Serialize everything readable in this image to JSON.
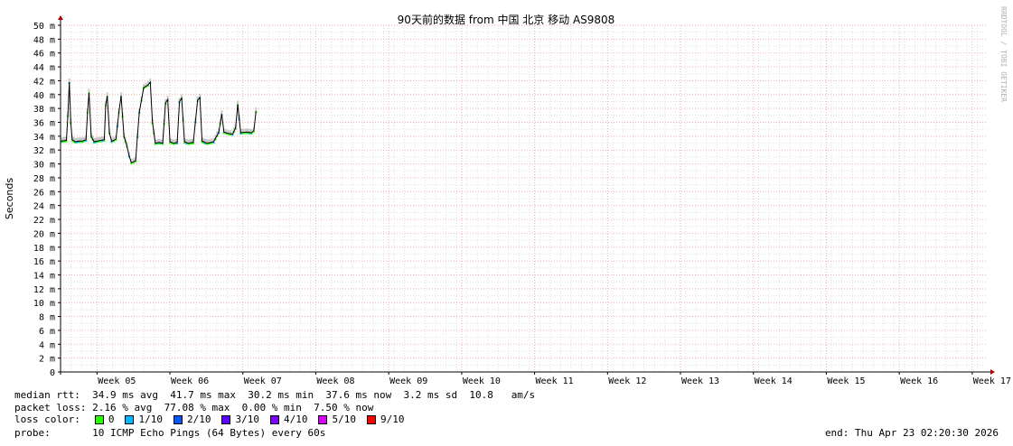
{
  "chart_data": {
    "type": "line",
    "title": "90天前的数据 from 中国 北京 移动 AS9808",
    "ylabel": "Seconds",
    "watermark": "RRDTOOL / TOBI OETIKER",
    "ylim": [
      0,
      50
    ],
    "y_unit": "ms",
    "yticks": [
      {
        "v": 0,
        "label": "0"
      },
      {
        "v": 2,
        "label": "2 m"
      },
      {
        "v": 4,
        "label": "4 m"
      },
      {
        "v": 6,
        "label": "6 m"
      },
      {
        "v": 8,
        "label": "8 m"
      },
      {
        "v": 10,
        "label": "10 m"
      },
      {
        "v": 12,
        "label": "12 m"
      },
      {
        "v": 14,
        "label": "14 m"
      },
      {
        "v": 16,
        "label": "16 m"
      },
      {
        "v": 18,
        "label": "18 m"
      },
      {
        "v": 20,
        "label": "20 m"
      },
      {
        "v": 22,
        "label": "22 m"
      },
      {
        "v": 24,
        "label": "24 m"
      },
      {
        "v": 26,
        "label": "26 m"
      },
      {
        "v": 28,
        "label": "28 m"
      },
      {
        "v": 30,
        "label": "30 m"
      },
      {
        "v": 32,
        "label": "32 m"
      },
      {
        "v": 34,
        "label": "34 m"
      },
      {
        "v": 36,
        "label": "36 m"
      },
      {
        "v": 38,
        "label": "38 m"
      },
      {
        "v": 40,
        "label": "40 m"
      },
      {
        "v": 42,
        "label": "42 m"
      },
      {
        "v": 44,
        "label": "44 m"
      },
      {
        "v": 46,
        "label": "46 m"
      },
      {
        "v": 48,
        "label": "48 m"
      },
      {
        "v": 50,
        "label": "50 m"
      }
    ],
    "xlim": [
      4.5,
      17.2
    ],
    "xticks": [
      {
        "v": 5,
        "label": "Week 05"
      },
      {
        "v": 6,
        "label": "Week 06"
      },
      {
        "v": 7,
        "label": "Week 07"
      },
      {
        "v": 8,
        "label": "Week 08"
      },
      {
        "v": 9,
        "label": "Week 09"
      },
      {
        "v": 10,
        "label": "Week 10"
      },
      {
        "v": 11,
        "label": "Week 11"
      },
      {
        "v": 12,
        "label": "Week 12"
      },
      {
        "v": 13,
        "label": "Week 13"
      },
      {
        "v": 14,
        "label": "Week 14"
      },
      {
        "v": 15,
        "label": "Week 15"
      },
      {
        "v": 16,
        "label": "Week 16"
      },
      {
        "v": 17,
        "label": "Week 17"
      }
    ],
    "grid": true,
    "series": [
      {
        "name": "median rtt",
        "x": [
          4.51,
          4.58,
          4.6,
          4.62,
          4.64,
          4.66,
          4.7,
          4.75,
          4.8,
          4.85,
          4.87,
          4.89,
          4.92,
          4.96,
          5.0,
          5.05,
          5.1,
          5.12,
          5.14,
          5.17,
          5.2,
          5.23,
          5.26,
          5.3,
          5.33,
          5.37,
          5.41,
          5.44,
          5.47,
          5.5,
          5.53,
          5.58,
          5.64,
          5.7,
          5.73,
          5.76,
          5.8,
          5.85,
          5.9,
          5.94,
          5.97,
          6.0,
          6.05,
          6.1,
          6.13,
          6.16,
          6.2,
          6.25,
          6.32,
          6.38,
          6.41,
          6.44,
          6.48,
          6.52,
          6.6,
          6.67,
          6.71,
          6.74,
          6.8,
          6.86,
          6.9,
          6.93,
          6.97,
          7.05,
          7.12,
          7.15,
          7.18
        ],
        "values": [
          33.3,
          33.4,
          37.0,
          41.8,
          36.0,
          33.5,
          33.2,
          33.3,
          33.3,
          33.5,
          37.5,
          40.3,
          34.0,
          33.2,
          33.3,
          33.4,
          33.5,
          38.5,
          39.8,
          34.5,
          33.3,
          33.4,
          33.6,
          37.5,
          39.8,
          34.0,
          32.6,
          31.2,
          30.2,
          30.3,
          30.5,
          37.5,
          41.0,
          41.4,
          41.8,
          36.0,
          33.0,
          33.1,
          33.0,
          38.8,
          39.3,
          33.2,
          33.0,
          33.1,
          39.0,
          39.5,
          33.2,
          33.0,
          33.1,
          39.2,
          39.6,
          33.3,
          33.1,
          33.0,
          33.2,
          34.6,
          37.2,
          34.6,
          34.4,
          34.3,
          35.2,
          38.6,
          34.5,
          34.6,
          34.5,
          34.8,
          37.6
        ]
      }
    ]
  },
  "info": {
    "median_rtt_label": "median rtt:",
    "median_rtt_values": "34.9 ms avg  41.7 ms max  30.2 ms min  37.6 ms now  3.2 ms sd  10.8   am/s",
    "packet_loss_label": "packet loss:",
    "packet_loss_values": "2.16 % avg  77.08 % max  0.00 % min  7.50 % now",
    "loss_color_label": "loss color:",
    "loss_colors": [
      {
        "label": "0",
        "color": "#26ff00"
      },
      {
        "label": "1/10",
        "color": "#00b8ff"
      },
      {
        "label": "2/10",
        "color": "#0059ff"
      },
      {
        "label": "3/10",
        "color": "#5e00ff"
      },
      {
        "label": "4/10",
        "color": "#7e00ff"
      },
      {
        "label": "5/10",
        "color": "#dd00ff"
      },
      {
        "label": "9/10",
        "color": "#ff0000"
      }
    ],
    "probe_label": "probe:",
    "probe_value": "10 ICMP Echo Pings (64 Bytes) every 60s",
    "end_text": "end: Thu Apr 23 02:20:30 2026"
  },
  "colors": {
    "minor_grid": "#e0e0e0",
    "major_grid": "#f0b0b0",
    "axis": "#000000",
    "arrow": "#aa0000",
    "smoke": "#bbbbbb",
    "watermark": "#b0b0b0"
  }
}
